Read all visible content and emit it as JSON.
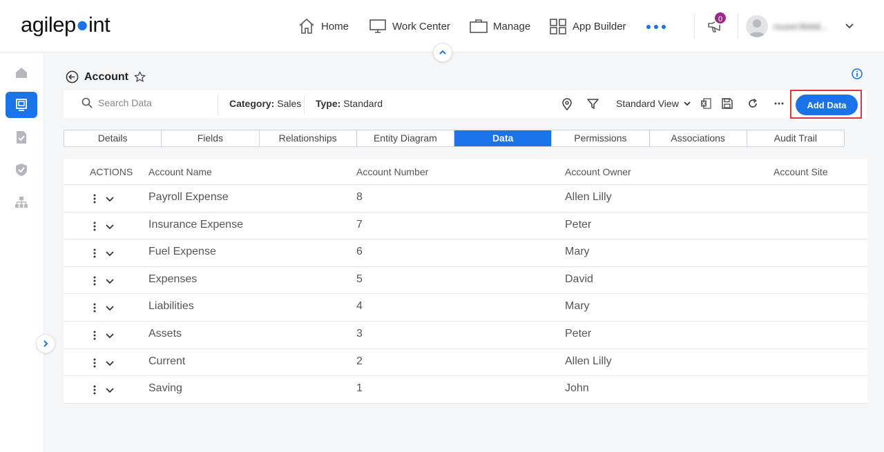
{
  "header": {
    "logo_text_a": "agilep",
    "logo_text_b": "int",
    "nav": [
      "Home",
      "Work Center",
      "Manage",
      "App Builder"
    ],
    "notification_count": "0",
    "user_name": "rsuser3bldd..."
  },
  "page": {
    "title": "Account"
  },
  "toolbar": {
    "search_placeholder": "Search Data",
    "category_label": "Category:",
    "category_value": "Sales",
    "type_label": "Type:",
    "type_value": "Standard",
    "view_label": "Standard View",
    "add_button": "Add Data"
  },
  "tabs": [
    "Details",
    "Fields",
    "Relationships",
    "Entity Diagram",
    "Data",
    "Permissions",
    "Associations",
    "Audit Trail"
  ],
  "active_tab": "Data",
  "table": {
    "columns": [
      "ACTIONS",
      "Account Name",
      "Account Number",
      "Account Owner",
      "Account Site"
    ],
    "rows": [
      {
        "name": "Payroll Expense",
        "number": "8",
        "owner": "Allen Lilly",
        "site": ""
      },
      {
        "name": "Insurance Expense",
        "number": "7",
        "owner": "Peter",
        "site": ""
      },
      {
        "name": "Fuel Expense",
        "number": "6",
        "owner": "Mary",
        "site": ""
      },
      {
        "name": "Expenses",
        "number": "5",
        "owner": "David",
        "site": ""
      },
      {
        "name": "Liabilities",
        "number": "4",
        "owner": "Mary",
        "site": ""
      },
      {
        "name": "Assets",
        "number": "3",
        "owner": "Peter",
        "site": ""
      },
      {
        "name": "Current",
        "number": "2",
        "owner": "Allen Lilly",
        "site": ""
      },
      {
        "name": "Saving",
        "number": "1",
        "owner": "John",
        "site": ""
      }
    ]
  },
  "colors": {
    "accent": "#1a73e8",
    "highlight": "#d73a3a",
    "badge": "#9c2a8a"
  }
}
